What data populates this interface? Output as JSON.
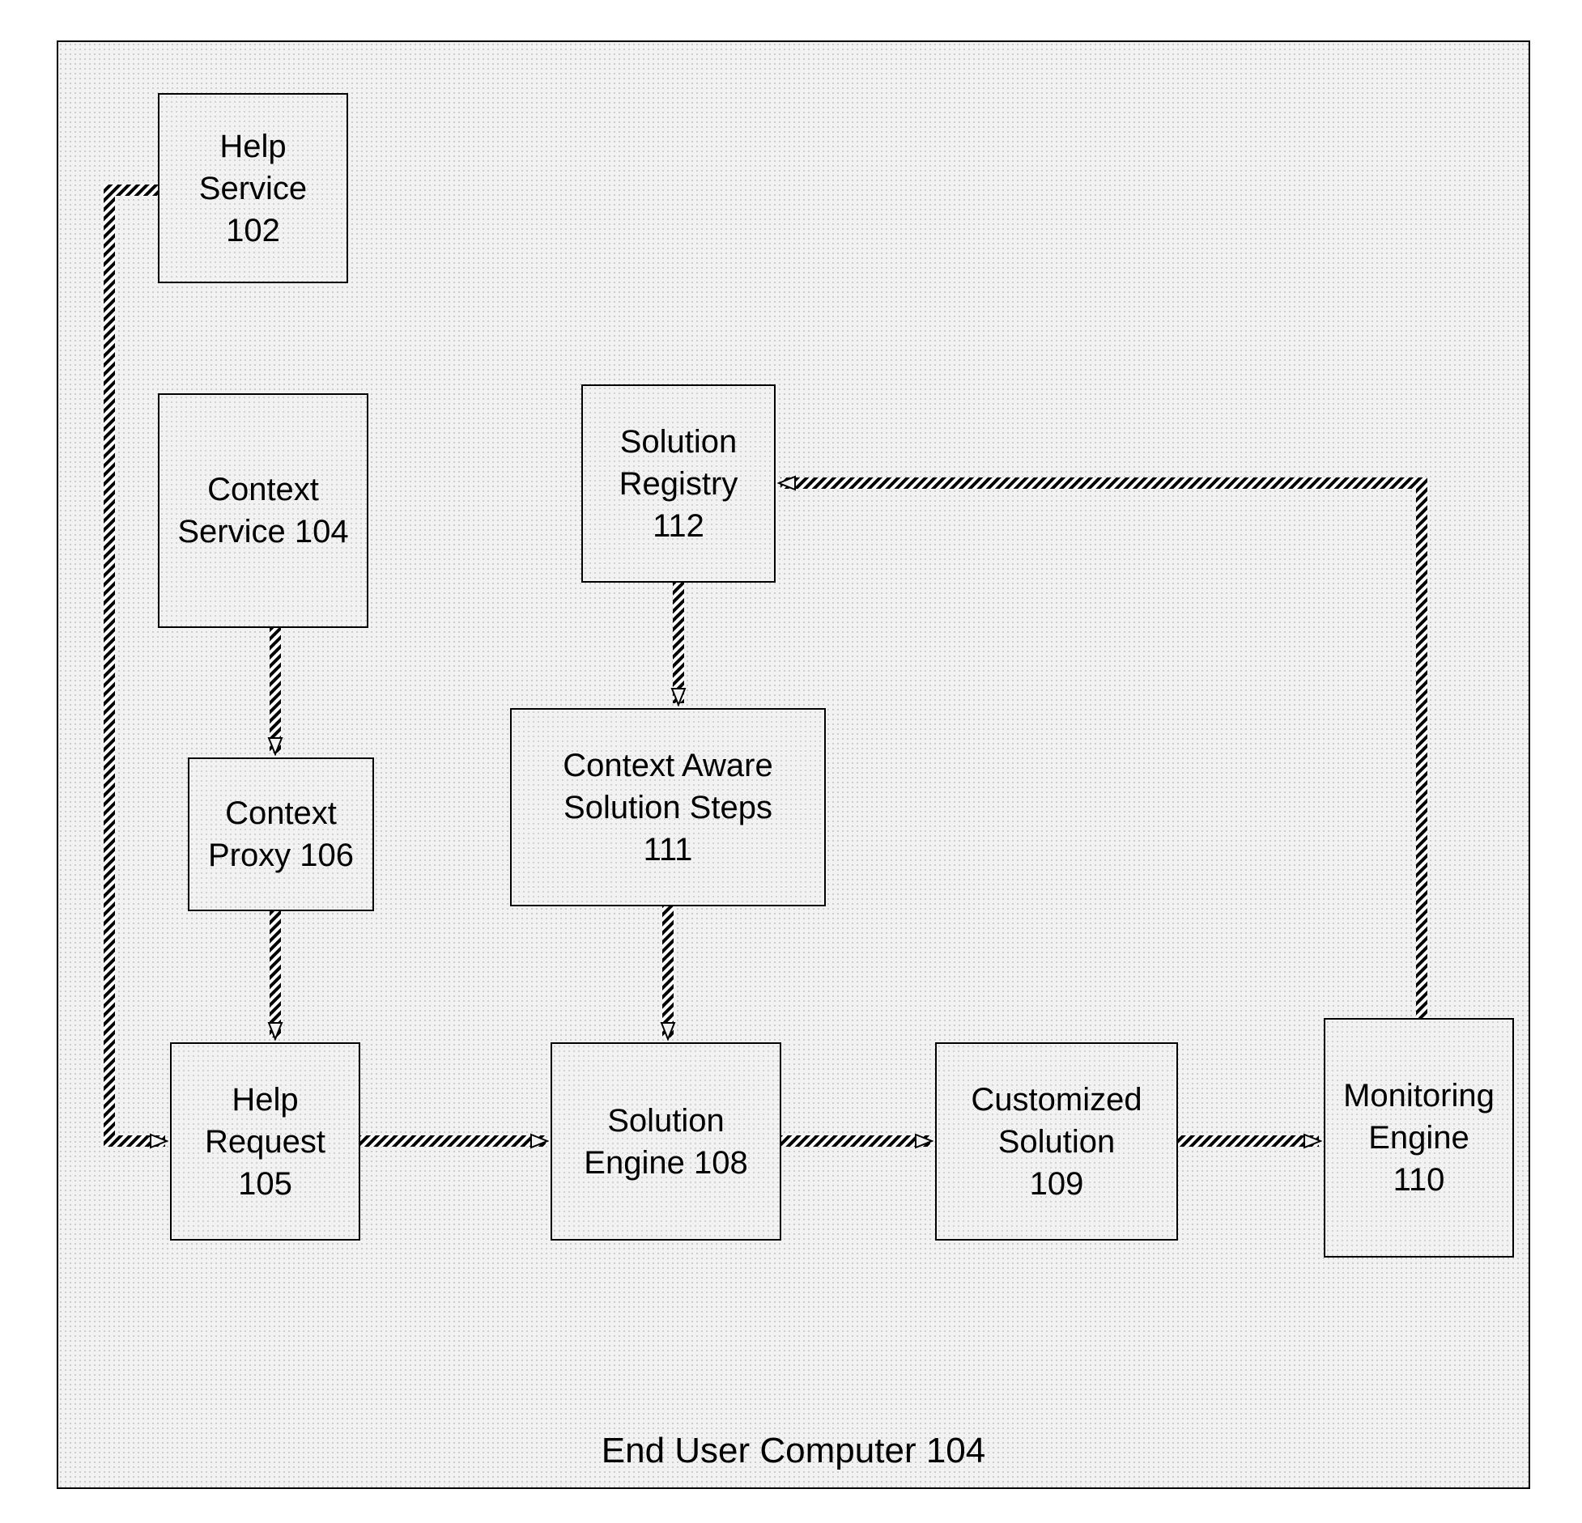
{
  "container": {
    "label": "End User Computer 104"
  },
  "nodes": {
    "help_service": {
      "label1": "Help",
      "label2": "Service",
      "label3": "102"
    },
    "context_service": {
      "label1": "Context",
      "label2": "Service 104"
    },
    "context_proxy": {
      "label1": "Context",
      "label2": "Proxy 106"
    },
    "help_request": {
      "label1": "Help",
      "label2": "Request",
      "label3": "105"
    },
    "solution_registry": {
      "label1": "Solution",
      "label2": "Registry",
      "label3": "112"
    },
    "context_aware": {
      "label1": "Context Aware",
      "label2": "Solution Steps",
      "label3": "111"
    },
    "solution_engine": {
      "label1": "Solution",
      "label2": "Engine 108"
    },
    "customized_solution": {
      "label1": "Customized",
      "label2": "Solution",
      "label3": "109"
    },
    "monitoring_engine": {
      "label1": "Monitoring",
      "label2": "Engine",
      "label3": "110"
    }
  }
}
